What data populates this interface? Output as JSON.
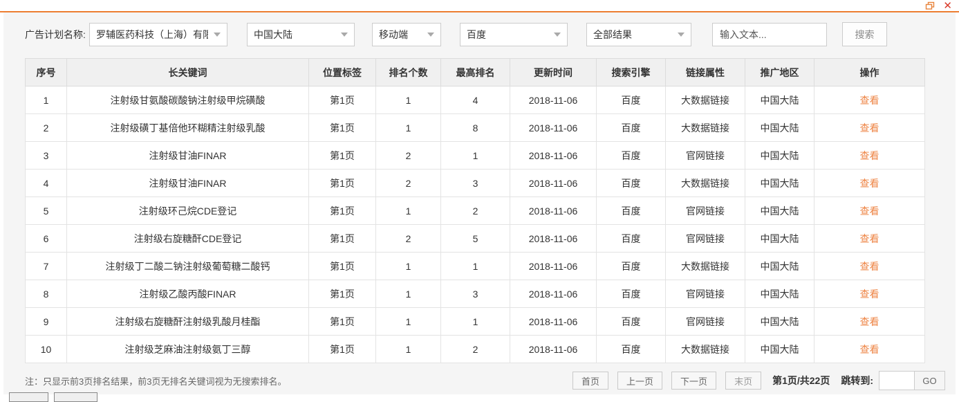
{
  "window": {
    "restore_icon": "restore-window",
    "close_icon": "close-window"
  },
  "colors": {
    "accent_orange": "#ed7d31",
    "link_orange": "#ee8444",
    "close_red": "#d93b2b",
    "panel_gray": "#f5f5f5"
  },
  "filters": {
    "plan_label": "广告计划名称:",
    "plan_value": "罗辅医药科技（上海）有限公...",
    "region_value": "中国大陆",
    "device_value": "移动端",
    "engine_value": "百度",
    "result_value": "全部结果",
    "search_placeholder": "输入文本...",
    "search_button": "搜索"
  },
  "table": {
    "columns": [
      "序号",
      "长关键词",
      "位置标签",
      "排名个数",
      "最高排名",
      "更新时间",
      "搜索引擎",
      "链接属性",
      "推广地区",
      "操作"
    ],
    "rows": [
      [
        "1",
        "注射级甘氨酸碳酸钠注射级甲烷磺酸",
        "第1页",
        "1",
        "4",
        "2018-11-06",
        "百度",
        "大数据链接",
        "中国大陆",
        "查看"
      ],
      [
        "2",
        "注射级磺丁基倍他环糊精注射级乳酸",
        "第1页",
        "1",
        "8",
        "2018-11-06",
        "百度",
        "大数据链接",
        "中国大陆",
        "查看"
      ],
      [
        "3",
        "注射级甘油FINAR",
        "第1页",
        "2",
        "1",
        "2018-11-06",
        "百度",
        "官网链接",
        "中国大陆",
        "查看"
      ],
      [
        "4",
        "注射级甘油FINAR",
        "第1页",
        "2",
        "3",
        "2018-11-06",
        "百度",
        "大数据链接",
        "中国大陆",
        "查看"
      ],
      [
        "5",
        "注射级环己烷CDE登记",
        "第1页",
        "1",
        "2",
        "2018-11-06",
        "百度",
        "官网链接",
        "中国大陆",
        "查看"
      ],
      [
        "6",
        "注射级右旋糖酐CDE登记",
        "第1页",
        "2",
        "5",
        "2018-11-06",
        "百度",
        "官网链接",
        "中国大陆",
        "查看"
      ],
      [
        "7",
        "注射级丁二酸二钠注射级葡萄糖二酸钙",
        "第1页",
        "1",
        "1",
        "2018-11-06",
        "百度",
        "大数据链接",
        "中国大陆",
        "查看"
      ],
      [
        "8",
        "注射级乙酸丙酸FINAR",
        "第1页",
        "1",
        "3",
        "2018-11-06",
        "百度",
        "官网链接",
        "中国大陆",
        "查看"
      ],
      [
        "9",
        "注射级右旋糖酐注射级乳酸月桂酯",
        "第1页",
        "1",
        "1",
        "2018-11-06",
        "百度",
        "官网链接",
        "中国大陆",
        "查看"
      ],
      [
        "10",
        "注射级芝麻油注射级氨丁三醇",
        "第1页",
        "1",
        "2",
        "2018-11-06",
        "百度",
        "大数据链接",
        "中国大陆",
        "查看"
      ]
    ]
  },
  "footer": {
    "note": "注：只显示前3页排名结果，前3页无排名关键词视为无搜索排名。",
    "pagination": {
      "first": "首页",
      "prev": "上一页",
      "next": "下一页",
      "last": "末页",
      "status": "第1页/共22页",
      "jump_label": "跳转到:",
      "jump_value": "",
      "go": "GO"
    }
  }
}
